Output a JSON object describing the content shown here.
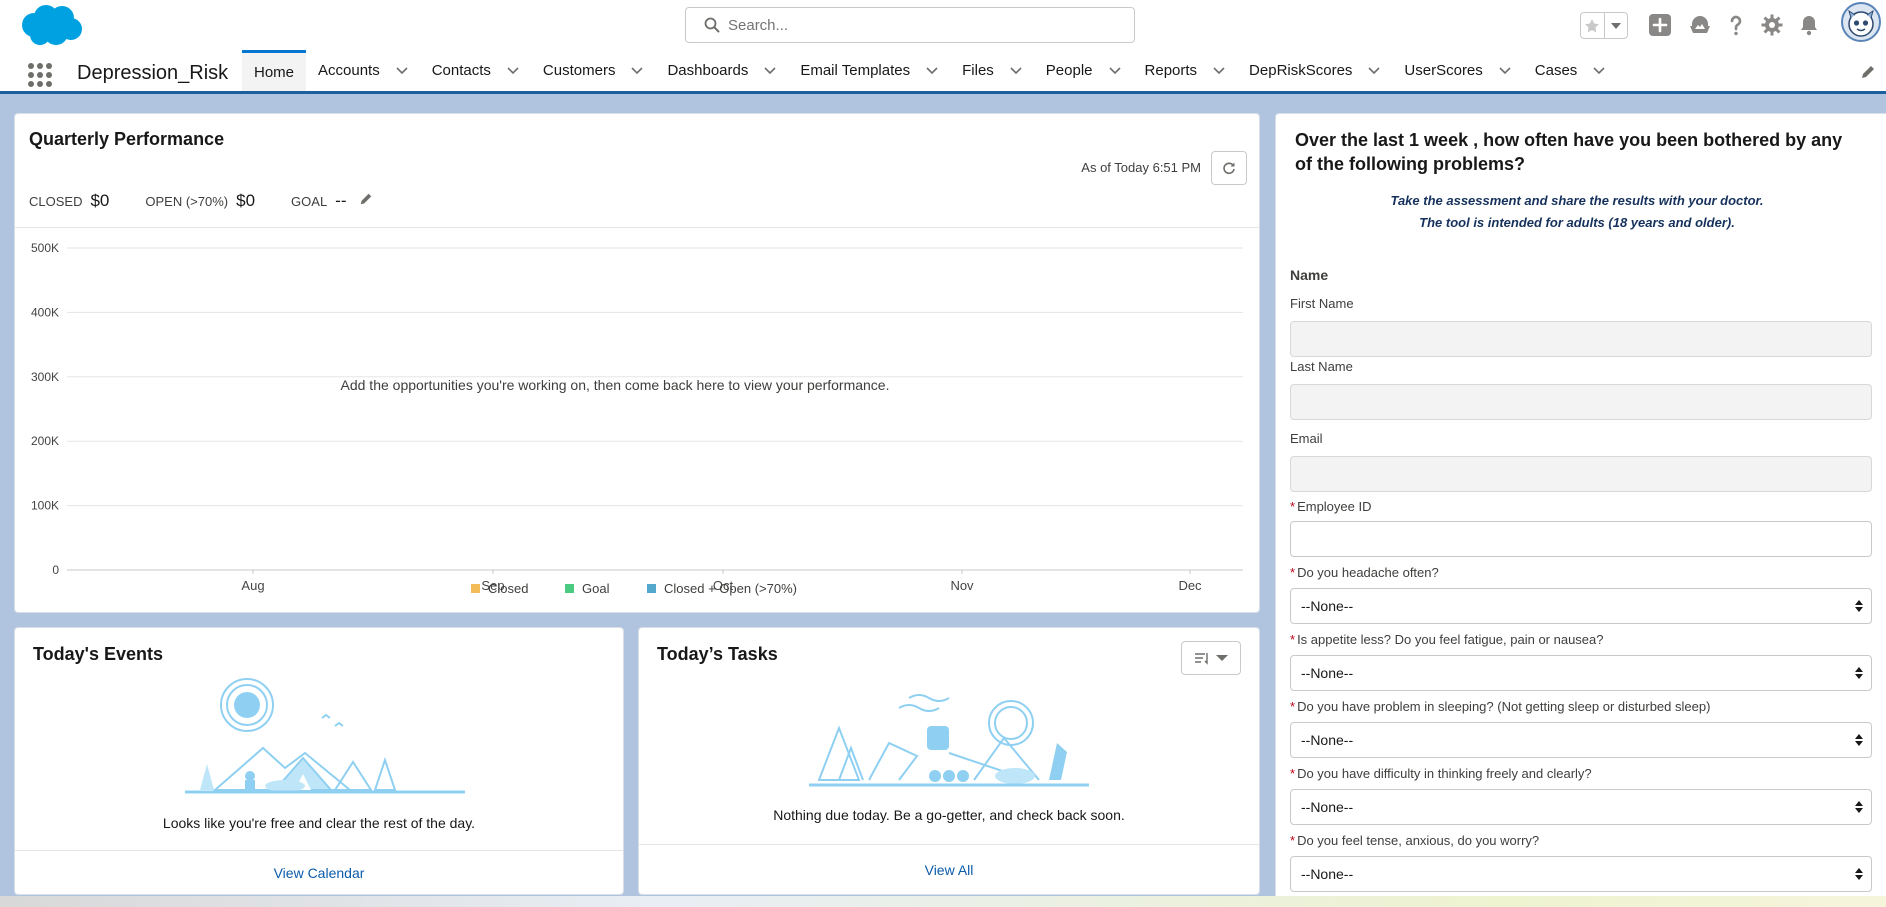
{
  "header": {
    "search_placeholder": "Search..."
  },
  "nav": {
    "app_name": "Depression_Risk",
    "items": [
      {
        "label": "Home",
        "active": true,
        "has_menu": false
      },
      {
        "label": "Accounts",
        "active": false,
        "has_menu": true
      },
      {
        "label": "Contacts",
        "active": false,
        "has_menu": true
      },
      {
        "label": "Customers",
        "active": false,
        "has_menu": true
      },
      {
        "label": "Dashboards",
        "active": false,
        "has_menu": true
      },
      {
        "label": "Email Templates",
        "active": false,
        "has_menu": true
      },
      {
        "label": "Files",
        "active": false,
        "has_menu": true
      },
      {
        "label": "People",
        "active": false,
        "has_menu": true
      },
      {
        "label": "Reports",
        "active": false,
        "has_menu": true
      },
      {
        "label": "DepRiskScores",
        "active": false,
        "has_menu": true
      },
      {
        "label": "UserScores",
        "active": false,
        "has_menu": true
      },
      {
        "label": "Cases",
        "active": false,
        "has_menu": true
      }
    ]
  },
  "performance": {
    "title": "Quarterly Performance",
    "as_of": "As of Today 6:51 PM",
    "closed_label": "CLOSED",
    "closed_value": "$0",
    "open_label": "OPEN (>70%)",
    "open_value": "$0",
    "goal_label": "GOAL",
    "goal_value": "--",
    "empty_message": "Add the opportunities you're working on, then come back here to view your performance."
  },
  "chart_data": {
    "type": "line",
    "title": "",
    "xlabel": "",
    "ylabel": "",
    "categories": [
      "Aug",
      "Sep",
      "Oct",
      "Nov",
      "Dec"
    ],
    "y_ticks": [
      "0",
      "100K",
      "200K",
      "300K",
      "400K",
      "500K"
    ],
    "ylim": [
      0,
      500000
    ],
    "grid": true,
    "legend_position": "bottom",
    "series": [
      {
        "name": "Closed",
        "color": "#f4bc59",
        "values": []
      },
      {
        "name": "Goal",
        "color": "#4bca81",
        "values": []
      },
      {
        "name": "Closed + Open (>70%)",
        "color": "#54a8cc",
        "values": []
      }
    ]
  },
  "events": {
    "title": "Today's Events",
    "empty_message": "Looks like you're free and clear the rest of the day.",
    "footer_link": "View Calendar"
  },
  "tasks": {
    "title": "Today’s Tasks",
    "empty_message": "Nothing due today. Be a go-getter, and check back soon.",
    "footer_link": "View All"
  },
  "form": {
    "question": "Over the last 1 week , how often have you been bothered by any of the following problems?",
    "subtitle_line1": "Take the assessment and share the results with your doctor.",
    "subtitle_line2": "The tool is intended for adults (18 years and older).",
    "name_section": "Name",
    "first_name_label": "First Name",
    "last_name_label": "Last Name",
    "email_label": "Email",
    "employee_id_label": "Employee ID",
    "required_marker": "*",
    "questions": [
      {
        "label": "Do you headache often?",
        "value": "--None--"
      },
      {
        "label": "Is appetite less? Do you feel fatigue, pain or nausea?",
        "value": "--None--"
      },
      {
        "label": "Do you have problem in sleeping? (Not getting sleep or disturbed sleep)",
        "value": "--None--"
      },
      {
        "label": "Do you have difficulty in thinking freely and clearly?",
        "value": "--None--"
      },
      {
        "label": "Do you feel tense, anxious, do you worry?",
        "value": "--None--"
      }
    ]
  }
}
